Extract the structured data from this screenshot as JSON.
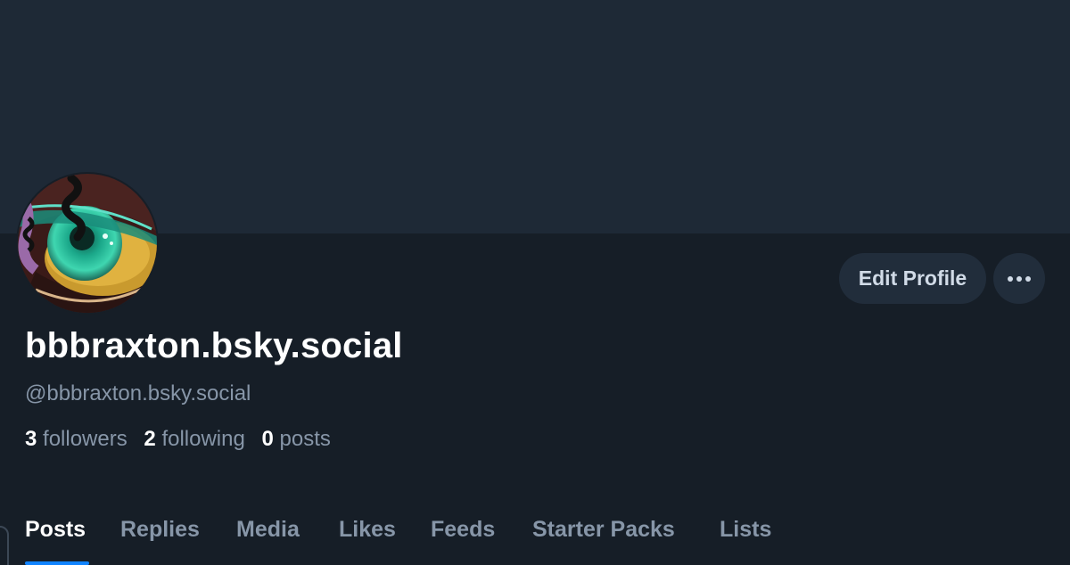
{
  "profile": {
    "display_name": "bbbraxton.bsky.social",
    "handle": "@bbbraxton.bsky.social",
    "avatar_icon": "eye-artwork-avatar"
  },
  "actions": {
    "edit_profile_label": "Edit Profile",
    "more_icon": "ellipsis-icon"
  },
  "stats": [
    {
      "value": "3",
      "label": "followers"
    },
    {
      "value": "2",
      "label": "following"
    },
    {
      "value": "0",
      "label": "posts"
    }
  ],
  "tabs": [
    {
      "label": "Posts",
      "active": true
    },
    {
      "label": "Replies",
      "active": false
    },
    {
      "label": "Media",
      "active": false
    },
    {
      "label": "Likes",
      "active": false
    },
    {
      "label": "Feeds",
      "active": false
    },
    {
      "label": "Starter Packs",
      "active": false
    },
    {
      "label": "Lists",
      "active": false
    }
  ],
  "colors": {
    "banner": "#1e2936",
    "background": "#161e27",
    "accent": "#1083fe",
    "muted_text": "#8796a8",
    "button_bg": "#212d3b"
  }
}
